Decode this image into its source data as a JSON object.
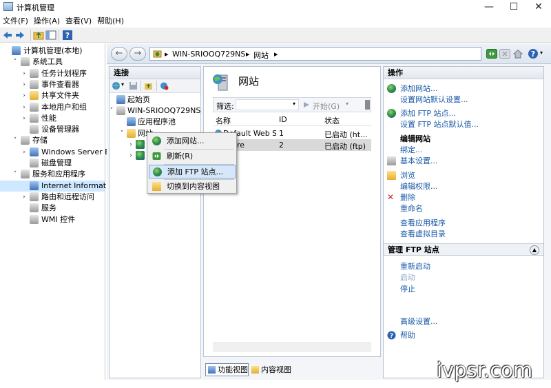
{
  "window": {
    "title": "计算机管理",
    "minimize": "—",
    "maximize": "☐",
    "close": "✕"
  },
  "menu": [
    "文件(F)",
    "操作(A)",
    "查看(V)",
    "帮助(H)"
  ],
  "tree": [
    {
      "label": "计算机管理(本地)",
      "arrow": "",
      "indent": 0
    },
    {
      "label": "系统工具",
      "arrow": "˅",
      "indent": 1
    },
    {
      "label": "任务计划程序",
      "arrow": "›",
      "indent": 2
    },
    {
      "label": "事件查看器",
      "arrow": "›",
      "indent": 2
    },
    {
      "label": "共享文件夹",
      "arrow": "›",
      "indent": 2
    },
    {
      "label": "本地用户和组",
      "arrow": "›",
      "indent": 2
    },
    {
      "label": "性能",
      "arrow": "›",
      "indent": 2
    },
    {
      "label": "设备管理器",
      "arrow": "",
      "indent": 2
    },
    {
      "label": "存储",
      "arrow": "˅",
      "indent": 1
    },
    {
      "label": "Windows Server Back",
      "arrow": "›",
      "indent": 2
    },
    {
      "label": "磁盘管理",
      "arrow": "",
      "indent": 2
    },
    {
      "label": "服务和应用程序",
      "arrow": "˅",
      "indent": 1
    },
    {
      "label": "Internet Information S",
      "arrow": "",
      "indent": 2,
      "selected": true
    },
    {
      "label": "路由和远程访问",
      "arrow": "›",
      "indent": 2
    },
    {
      "label": "服务",
      "arrow": "",
      "indent": 2
    },
    {
      "label": "WMI 控件",
      "arrow": "",
      "indent": 2
    }
  ],
  "address": {
    "sep1": "▸",
    "server": "WIN-SRIOOQ729NS",
    "sep2": "▸",
    "node": "网站",
    "sep3": "▸"
  },
  "connections": {
    "title": "连接",
    "items": [
      {
        "label": "起始页",
        "arrow": ""
      },
      {
        "label": "WIN-SRIOOQ729NS",
        "arrow": "˅"
      },
      {
        "label": "应用程序池",
        "arrow": ""
      },
      {
        "label": "网站",
        "arrow": "˅"
      },
      {
        "label": "",
        "arrow": "›"
      },
      {
        "label": "",
        "arrow": "›"
      }
    ]
  },
  "center": {
    "heading": "网站",
    "filter_label": "筛选:",
    "start_label": "开始(G)",
    "columns": [
      "名称",
      "ID",
      "状态"
    ],
    "rows": [
      {
        "name": "Default Web S...",
        "id": "1",
        "status": "已启动 (ht..."
      },
      {
        "name": "re",
        "id": "2",
        "status": "已启动 (ftp)"
      }
    ]
  },
  "view_tabs": {
    "feature": "功能视图",
    "content": "内容视图"
  },
  "actions": {
    "title": "操作",
    "items": [
      {
        "label": "添加网站...",
        "style": "link",
        "icon": "globe"
      },
      {
        "label": "设置网站默认设置...",
        "style": "link",
        "icon": ""
      },
      {
        "label": "添加 FTP 站点...",
        "style": "link",
        "icon": "globe"
      },
      {
        "label": "设置 FTP 站点默认值...",
        "style": "link",
        "icon": ""
      },
      {
        "label": "编辑网站",
        "style": "bold",
        "icon": ""
      },
      {
        "label": "绑定...",
        "style": "link",
        "icon": ""
      },
      {
        "label": "基本设置...",
        "style": "link",
        "icon": "doc"
      },
      {
        "label": "浏览",
        "style": "link",
        "icon": "folder"
      },
      {
        "label": "编辑权限...",
        "style": "link",
        "icon": ""
      },
      {
        "label": "删除",
        "style": "link",
        "icon": "x"
      },
      {
        "label": "重命名",
        "style": "link",
        "icon": ""
      },
      {
        "label": "查看应用程序",
        "style": "link",
        "icon": ""
      },
      {
        "label": "查看虚拟目录",
        "style": "link",
        "icon": ""
      }
    ],
    "ftp_section_title": "管理 FTP 站点",
    "ftp_items": [
      {
        "label": "重新启动",
        "style": "link"
      },
      {
        "label": "启动",
        "style": "dis"
      },
      {
        "label": "停止",
        "style": "link"
      },
      {
        "label": "高级设置...",
        "style": "link"
      }
    ],
    "help": "帮助"
  },
  "context_menu": {
    "items": [
      "添加网站...",
      "刷新(R)",
      "添加 FTP 站点...",
      "切换到内容视图"
    ]
  },
  "watermark": "ivpsr.com",
  "colors": {
    "link": "#1a5aa8",
    "selection": "#cde8ff",
    "menu_highlight": "#d5e7f8"
  }
}
